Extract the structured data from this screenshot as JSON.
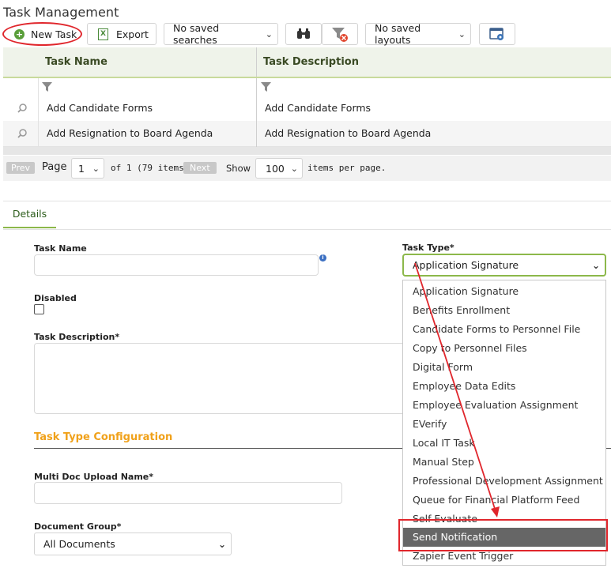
{
  "header": {
    "title": "Task Management"
  },
  "toolbar": {
    "new_task_label": "New Task",
    "export_label": "Export",
    "saved_searches": "No saved searches",
    "saved_layouts": "No saved layouts"
  },
  "grid": {
    "columns": [
      "Task Name",
      "Task Description"
    ],
    "rows": [
      {
        "name": "Add Candidate Forms",
        "description": "Add Candidate Forms"
      },
      {
        "name": "Add Resignation to Board Agenda",
        "description": "Add Resignation to Board Agenda"
      }
    ]
  },
  "pager": {
    "prev": "Prev",
    "page_label": "Page",
    "page_value": "1",
    "of_text": "of 1 (79 items)",
    "next": "Next",
    "show_label": "Show",
    "page_size": "100",
    "per_page_label": "items per page."
  },
  "details": {
    "tab_label": "Details",
    "task_name_label": "Task Name",
    "task_name_value": "",
    "task_type_label": "Task Type*",
    "task_type_value": "Application Signature",
    "disabled_label": "Disabled",
    "task_description_label": "Task Description*",
    "config_title": "Task Type Configuration",
    "multi_doc_label": "Multi Doc Upload Name*",
    "document_group_label": "Document Group*",
    "document_group_value": "All Documents"
  },
  "task_type_options": [
    "Application Signature",
    "Benefits Enrollment",
    "Candidate Forms to Personnel File",
    "Copy to Personnel Files",
    "Digital Form",
    "Employee Data Edits",
    "Employee Evaluation Assignment",
    "EVerify",
    "Local IT Task",
    "Manual Step",
    "Professional Development Assignment",
    "Queue for Financial Platform Feed",
    "Self-Evaluate",
    "Send Notification",
    "Zapier Event Trigger"
  ],
  "highlighted_option": "Send Notification",
  "colors": {
    "accent_green": "#8cb84a",
    "section_orange": "#f0a11a",
    "annotation_red": "#e0262c",
    "highlight_gray": "#666666"
  }
}
